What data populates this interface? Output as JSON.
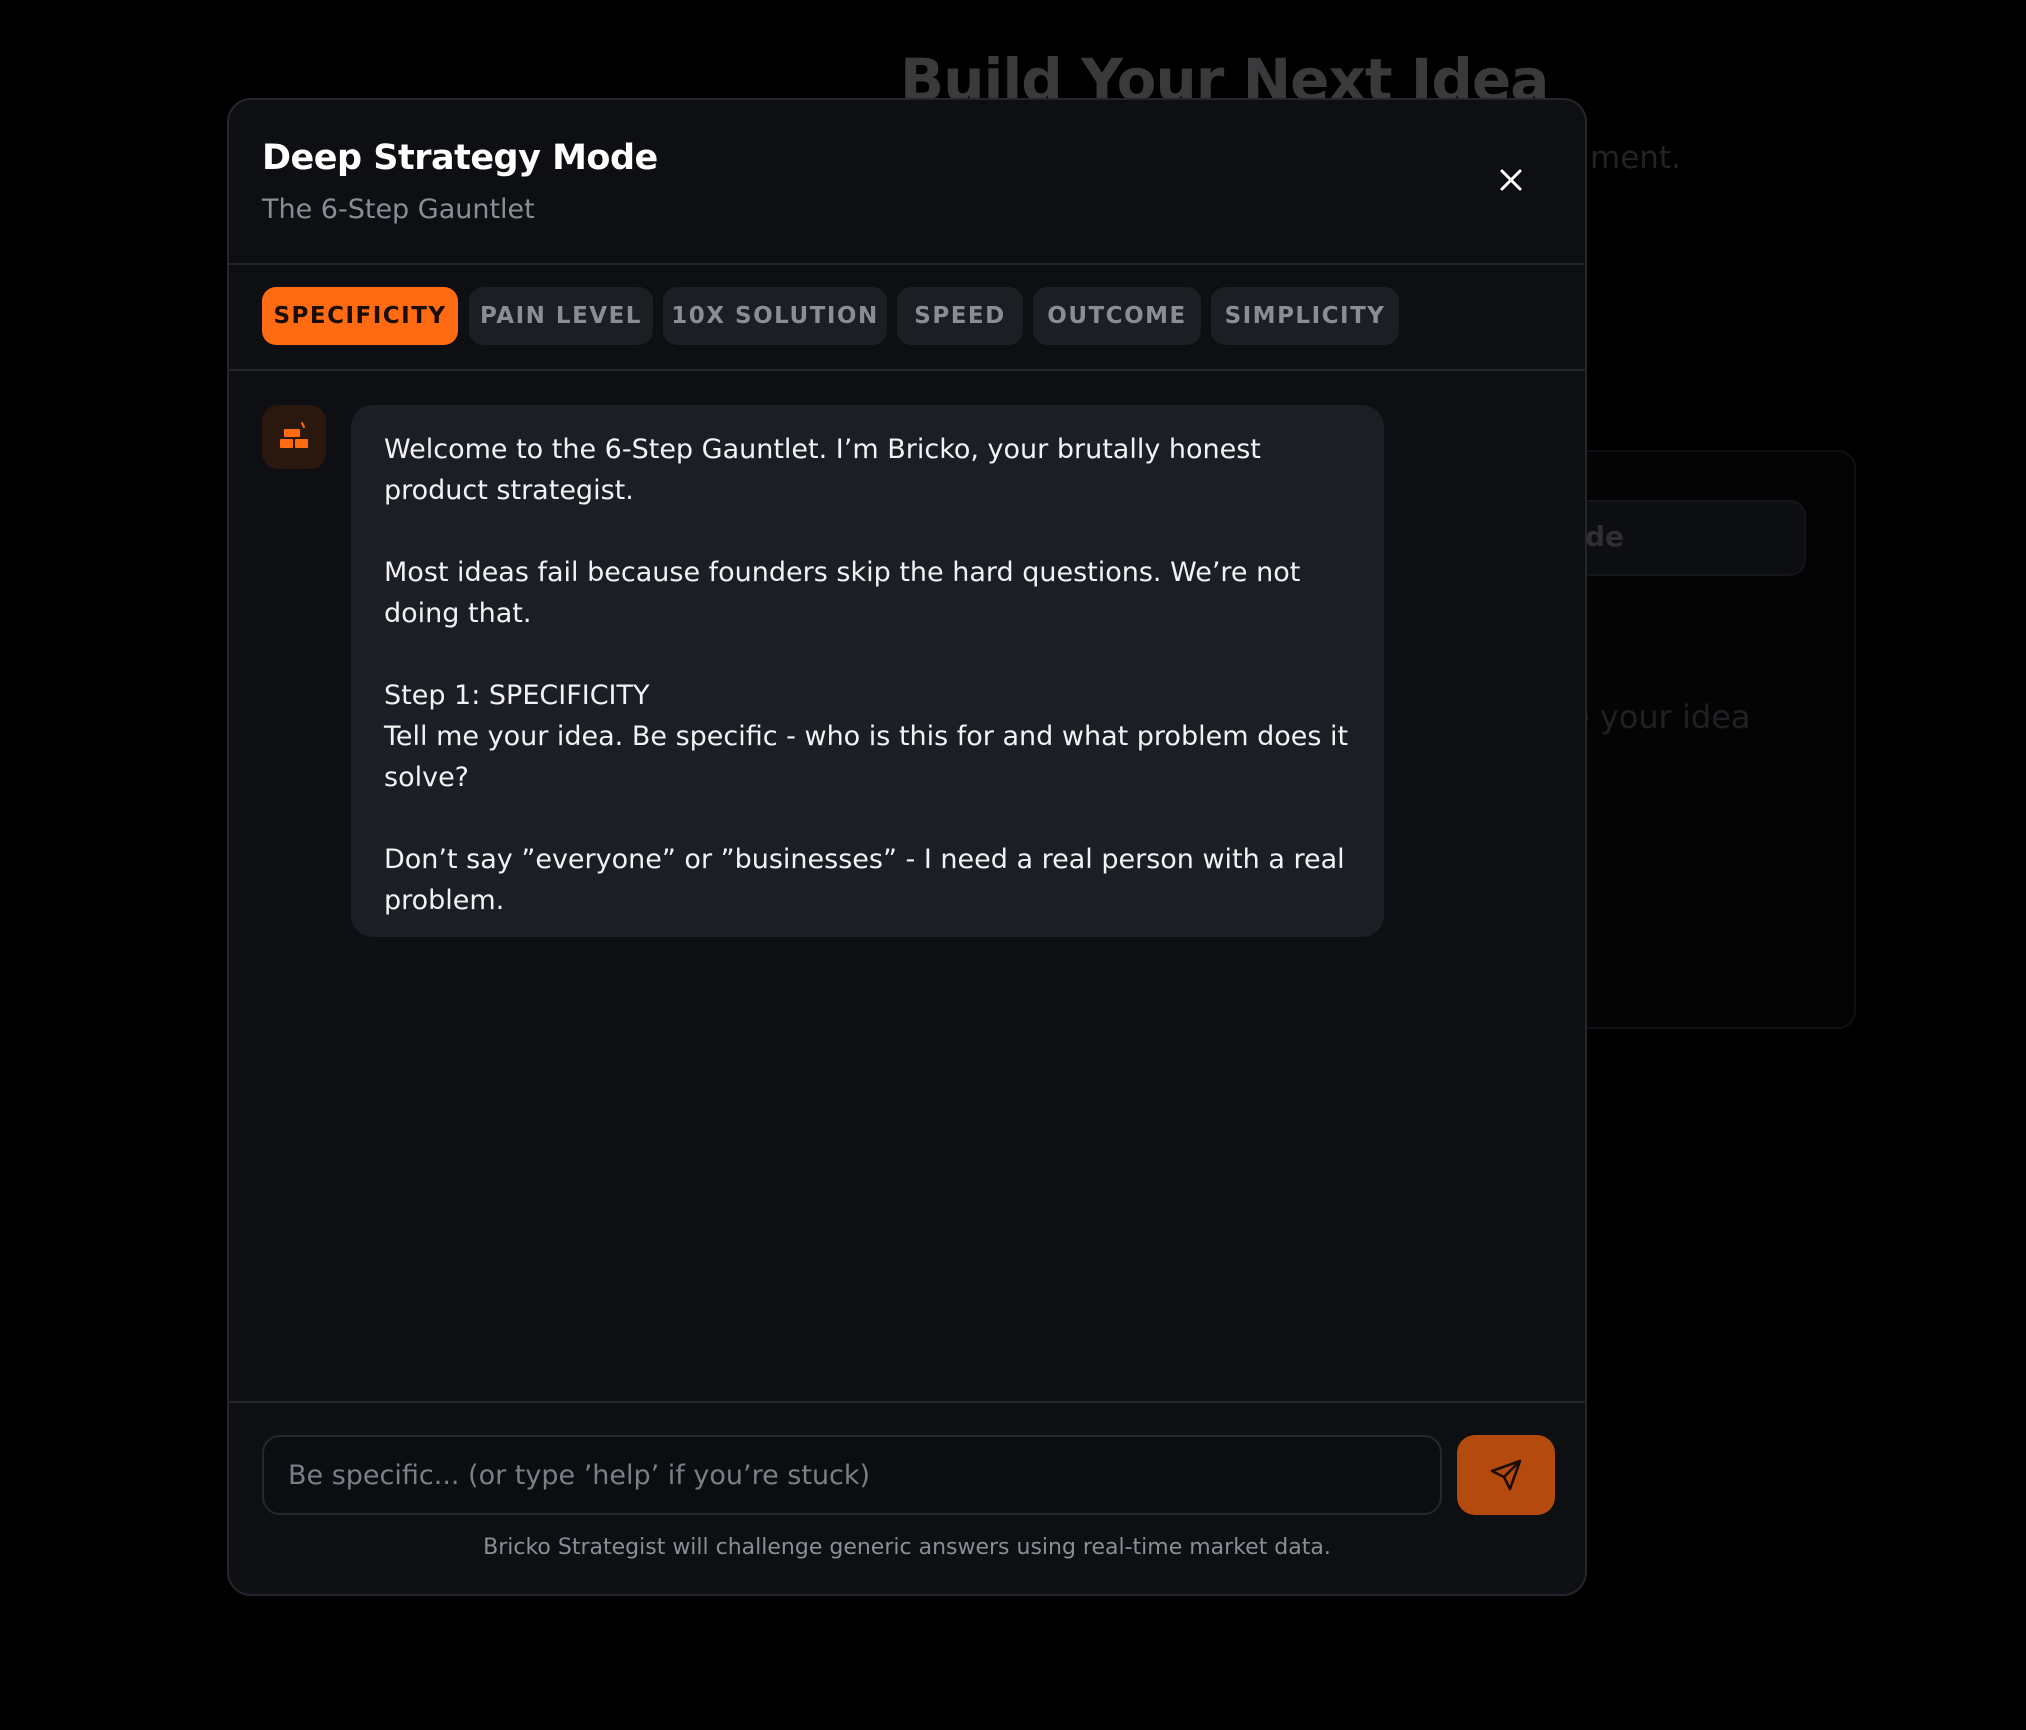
{
  "background": {
    "title": "Build Your Next Idea",
    "subtitle_fragment": "ment.",
    "pill_fragment": "de",
    "card_fragment": "e your idea"
  },
  "modal": {
    "title": "Deep Strategy Mode",
    "subtitle": "The 6-Step Gauntlet",
    "close_icon": "close-icon"
  },
  "tabs": [
    {
      "label": "SPECIFICITY",
      "active": true
    },
    {
      "label": "PAIN LEVEL",
      "active": false
    },
    {
      "label": "10X SOLUTION",
      "active": false
    },
    {
      "label": "SPEED",
      "active": false
    },
    {
      "label": "OUTCOME",
      "active": false
    },
    {
      "label": "SIMPLICITY",
      "active": false
    }
  ],
  "message": {
    "avatar_icon": "brick-icon",
    "paragraph1": "Welcome to the 6-Step Gauntlet. I’m Bricko, your brutally honest product strategist.",
    "paragraph2": "Most ideas fail because founders skip the hard questions. We’re not doing that.",
    "step_heading": "Step 1: SPECIFICITY",
    "step_body": "Tell me your idea. Be specific - who is this for and what problem does it solve?",
    "paragraph4": "Don’t say ”everyone” or ”businesses” - I need a real person with a real problem."
  },
  "composer": {
    "placeholder": "Be specific... (or type ’help’ if you’re stuck)",
    "value": "",
    "send_icon": "send-icon",
    "footnote": "Bricko Strategist will challenge generic answers using real-time market data."
  },
  "colors": {
    "accent": "#ff6a13",
    "send_button": "#b54a0e",
    "modal_bg": "#0d0f13",
    "bubble_bg": "#1c1e25"
  }
}
